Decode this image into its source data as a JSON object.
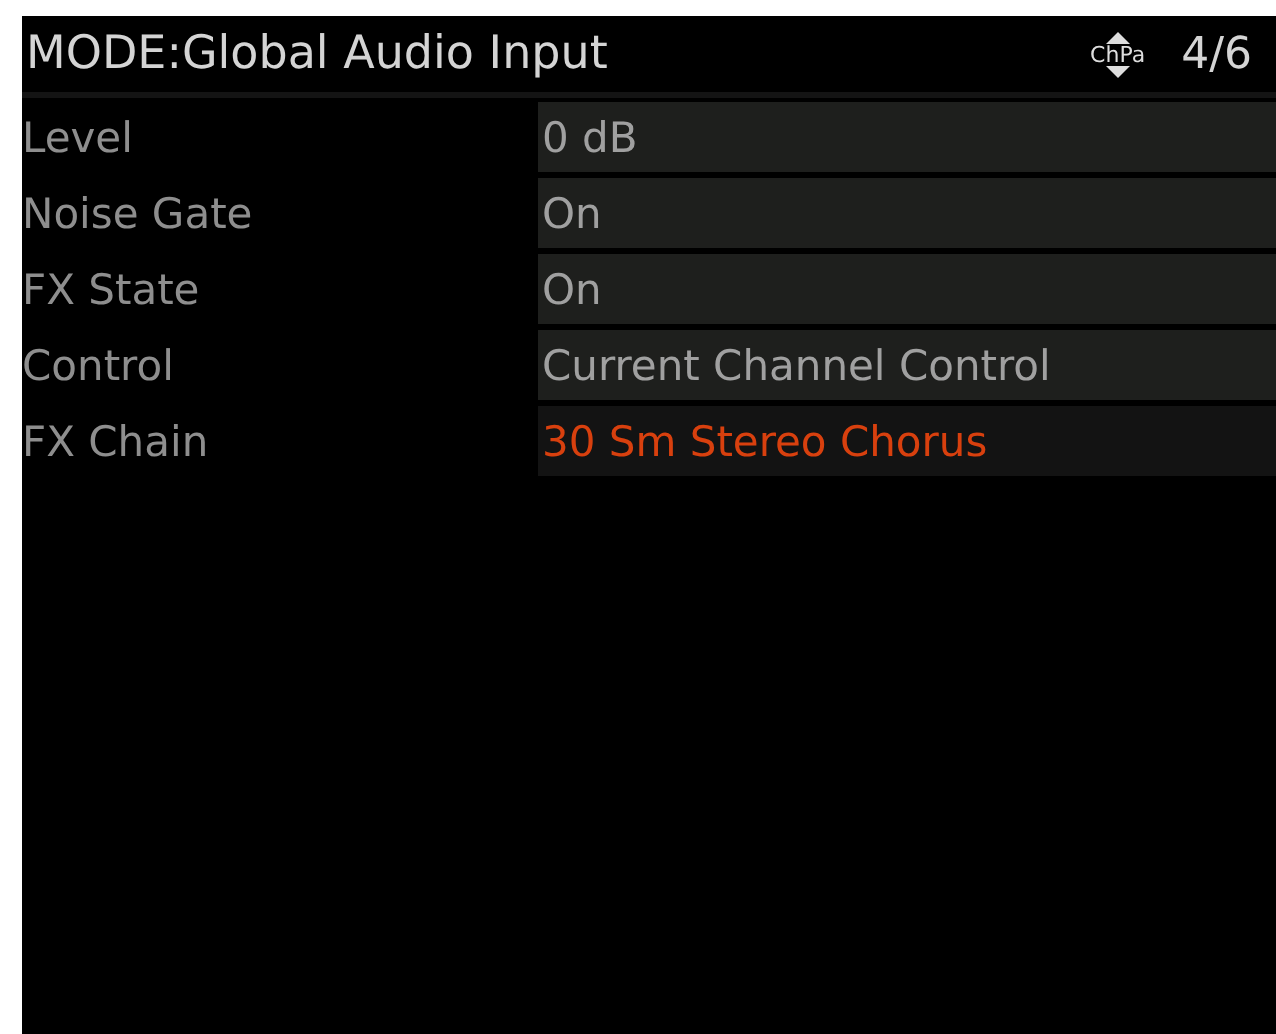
{
  "header": {
    "title": "MODE:Global Audio Input",
    "icon_text": "ChPa",
    "page": "4/6"
  },
  "rows": [
    {
      "label": "Level",
      "value": "0 dB",
      "selected": false
    },
    {
      "label": "Noise Gate",
      "value": "On",
      "selected": false
    },
    {
      "label": "FX State",
      "value": "On",
      "selected": false
    },
    {
      "label": "Control",
      "value": "Current Channel Control",
      "selected": false
    },
    {
      "label": "FX Chain",
      "value": "30 Sm Stereo Chorus",
      "selected": true
    }
  ]
}
